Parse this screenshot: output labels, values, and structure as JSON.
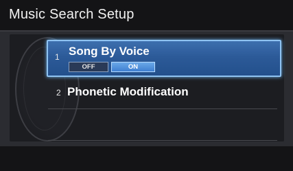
{
  "title": "Music Search Setup",
  "items": [
    {
      "number": "1",
      "label": "Song By Voice",
      "options": [
        "OFF",
        "ON"
      ],
      "selected_option": "ON",
      "selected": true
    },
    {
      "number": "2",
      "label": "Phonetic Modification",
      "selected": false
    }
  ],
  "colors": {
    "highlight": "#2c5a98",
    "highlight_border": "#8fc3f2",
    "background": "#1a1a1c"
  }
}
